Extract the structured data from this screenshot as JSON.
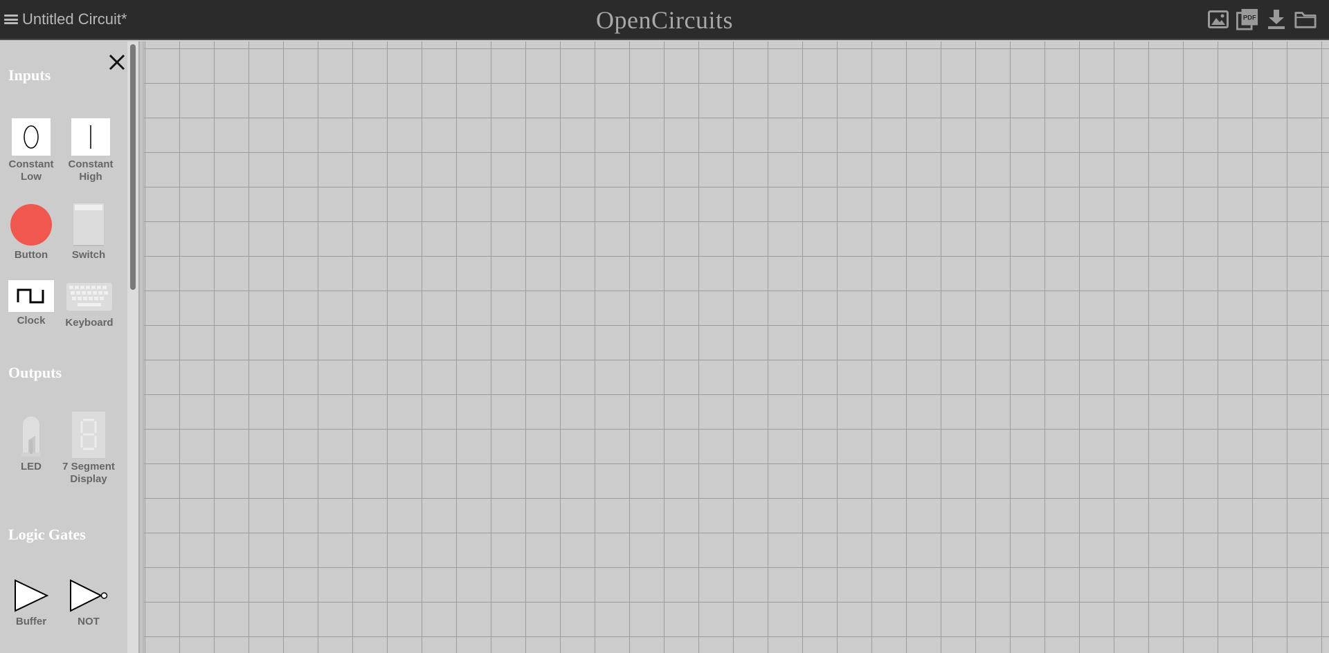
{
  "header": {
    "circuit_name": "Untitled Circuit*",
    "app_title": "OpenCircuits",
    "buttons": [
      {
        "name": "image-export",
        "icon": "image-icon"
      },
      {
        "name": "pdf-export",
        "icon": "pdf-icon",
        "text": "PDF"
      },
      {
        "name": "download",
        "icon": "download-icon"
      },
      {
        "name": "open-folder",
        "icon": "folder-icon"
      }
    ]
  },
  "sidebar": {
    "close_icon": "close-icon",
    "sections": [
      {
        "title": "Inputs",
        "items": [
          {
            "label": "Constant Low",
            "icon": "constant-low-icon"
          },
          {
            "label": "Constant High",
            "icon": "constant-high-icon"
          },
          {
            "label": "Button",
            "icon": "button-icon"
          },
          {
            "label": "Switch",
            "icon": "switch-icon"
          },
          {
            "label": "Clock",
            "icon": "clock-icon"
          },
          {
            "label": "Keyboard",
            "icon": "keyboard-icon"
          }
        ]
      },
      {
        "title": "Outputs",
        "items": [
          {
            "label": "LED",
            "icon": "led-icon"
          },
          {
            "label": "7 Segment Display",
            "icon": "seven-segment-icon"
          }
        ]
      },
      {
        "title": "Logic Gates",
        "items": [
          {
            "label": "Buffer",
            "icon": "buffer-gate-icon"
          },
          {
            "label": "NOT",
            "icon": "not-gate-icon"
          }
        ]
      }
    ]
  },
  "colors": {
    "header_bg": "#2b2b2b",
    "header_text": "#b8b8b8",
    "canvas_bg": "#cccccc",
    "grid_line": "#9c9c9c",
    "section_title": "#ffffff",
    "item_label": "#666666",
    "button_red": "#f0574f"
  }
}
